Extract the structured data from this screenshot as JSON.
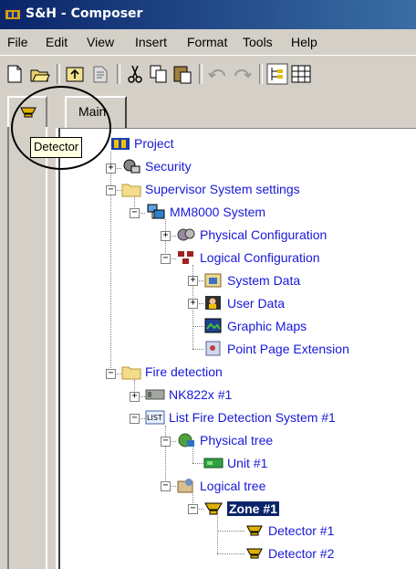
{
  "window": {
    "title": "S&H - Composer"
  },
  "menu": [
    "File",
    "Edit",
    "View",
    "Insert",
    "Format",
    "Tools",
    "Help"
  ],
  "toolbar": {
    "icons": [
      "new-document-icon",
      "open-folder-icon",
      "up-folder-icon",
      "properties-icon",
      "cut-icon",
      "copy-icon",
      "paste-icon",
      "undo-icon",
      "redo-icon",
      "tree-view-icon",
      "grid-view-icon"
    ]
  },
  "left_panel": {
    "tooltip": "Detector"
  },
  "tabs": {
    "main": "Main"
  },
  "tree": [
    {
      "label": "Project"
    },
    {
      "label": "Security"
    },
    {
      "label": "Supervisor System settings"
    },
    {
      "label": "MM8000 System"
    },
    {
      "label": "Physical Configuration"
    },
    {
      "label": "Logical Configuration"
    },
    {
      "label": "System Data"
    },
    {
      "label": "User Data"
    },
    {
      "label": "Graphic Maps"
    },
    {
      "label": "Point Page Extension"
    },
    {
      "label": "Fire detection"
    },
    {
      "label": "NK822x #1"
    },
    {
      "label": "List Fire Detection System #1"
    },
    {
      "label": "Physical tree"
    },
    {
      "label": "Unit #1"
    },
    {
      "label": "Logical tree"
    },
    {
      "label": "Zone #1",
      "selected": true
    },
    {
      "label": "Detector #1"
    },
    {
      "label": "Detector #2"
    }
  ],
  "colors": {
    "title_bar": "#0a246a",
    "tree_text": "#1818d8",
    "selection": "#0a246a",
    "tooltip_bg": "#ffffe1"
  }
}
